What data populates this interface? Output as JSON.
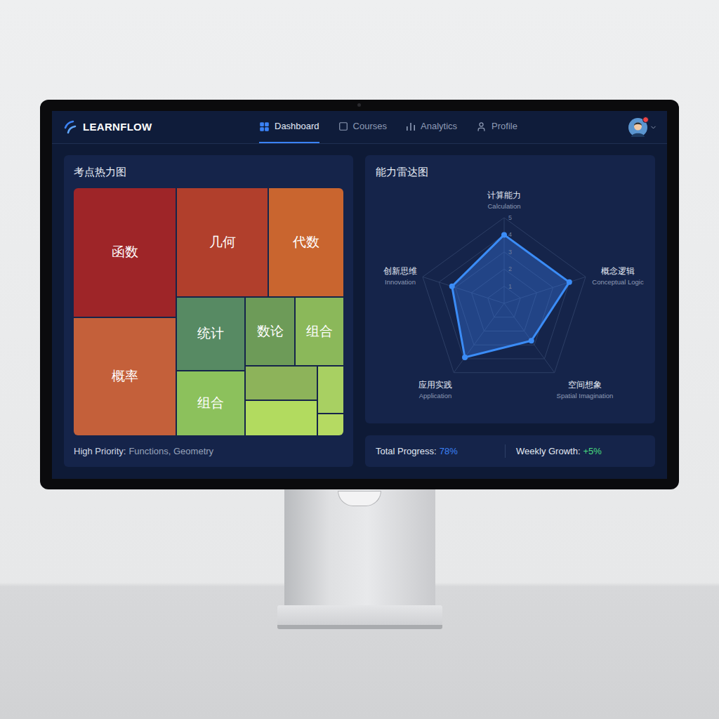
{
  "app": {
    "logo": "LEARNFLOW"
  },
  "nav": [
    {
      "label": "Dashboard",
      "selected": true
    },
    {
      "label": "Courses",
      "selected": false
    },
    {
      "label": "Analytics",
      "selected": false
    },
    {
      "label": "Profile",
      "selected": false
    }
  ],
  "user": {
    "notification": true
  },
  "heatmap": {
    "title": "考点热力图",
    "tiles": [
      {
        "label": "函数",
        "color": "#9e2528"
      },
      {
        "label": "概率",
        "color": "#c4603a"
      },
      {
        "label": "几何",
        "color": "#b13f2c"
      },
      {
        "label": "代数",
        "color": "#c9652f"
      },
      {
        "label": "统计",
        "color": "#578a63"
      },
      {
        "label": "组合",
        "color": "#8cc15c"
      },
      {
        "label": "数论",
        "color": "#6d9b58"
      },
      {
        "label": "组合",
        "color": "#8bb85a"
      },
      {
        "label": "",
        "color": "#8db35a"
      },
      {
        "label": "",
        "color": "#b2db5f"
      },
      {
        "label": "",
        "color": "#a8d062"
      },
      {
        "label": "",
        "color": "#b5da62"
      }
    ],
    "footer_label": "High Priority:",
    "footer_value": "Functions, Geometry"
  },
  "radar": {
    "title": "能力雷达图",
    "max": 5,
    "ticks": [
      "1",
      "2",
      "3",
      "4",
      "5"
    ],
    "axes": [
      {
        "label": "计算能力",
        "sublabel": "Calculation"
      },
      {
        "label": "概念逻辑",
        "sublabel": "Conceptual Logic"
      },
      {
        "label": "空间想象",
        "sublabel": "Spatial Imagination"
      },
      {
        "label": "应用实践",
        "sublabel": "Application"
      },
      {
        "label": "创新思维",
        "sublabel": "Innovation"
      }
    ],
    "series": [
      {
        "values": [
          4,
          4,
          2.7,
          3.9,
          3.2
        ]
      }
    ]
  },
  "stats": [
    {
      "label": "Total Progress:",
      "value": "78%",
      "color": "#3b82f6"
    },
    {
      "label": "Weekly Growth:",
      "value": "+5%",
      "color": "#4ade80"
    }
  ]
}
